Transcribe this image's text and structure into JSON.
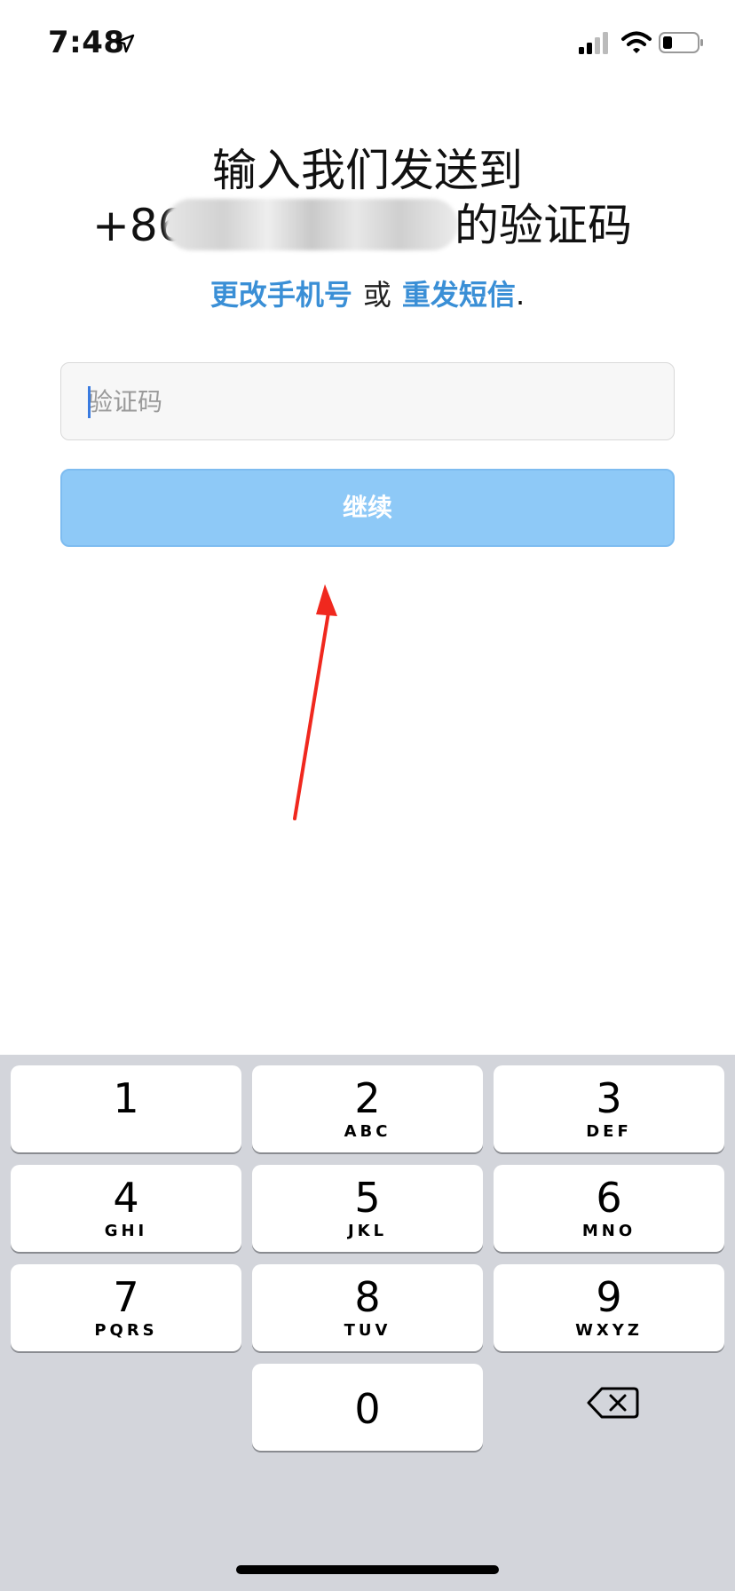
{
  "status_bar": {
    "time": "7:48",
    "icons": [
      "location-arrow-icon",
      "cellular-signal-icon",
      "wifi-icon",
      "battery-icon"
    ]
  },
  "heading": {
    "line1": "输入我们发送到",
    "phone_prefix": "+86",
    "line2_suffix": "的验证码"
  },
  "links": {
    "change_phone": "更改手机号",
    "or": "或",
    "resend_sms": "重发短信",
    "period": "."
  },
  "code_input": {
    "placeholder": "验证码",
    "value": ""
  },
  "continue_button": {
    "label": "继续"
  },
  "keypad": {
    "keys": [
      {
        "digit": "1",
        "letters": ""
      },
      {
        "digit": "2",
        "letters": "ABC"
      },
      {
        "digit": "3",
        "letters": "DEF"
      },
      {
        "digit": "4",
        "letters": "GHI"
      },
      {
        "digit": "5",
        "letters": "JKL"
      },
      {
        "digit": "6",
        "letters": "MNO"
      },
      {
        "digit": "7",
        "letters": "PQRS"
      },
      {
        "digit": "8",
        "letters": "TUV"
      },
      {
        "digit": "9",
        "letters": "WXYZ"
      },
      {
        "digit": "0",
        "letters": ""
      }
    ]
  },
  "colors": {
    "link": "#3a8fd6",
    "button": "#8ec9f7",
    "keypad_bg": "#d3d5db",
    "annotation": "#f0281e"
  }
}
